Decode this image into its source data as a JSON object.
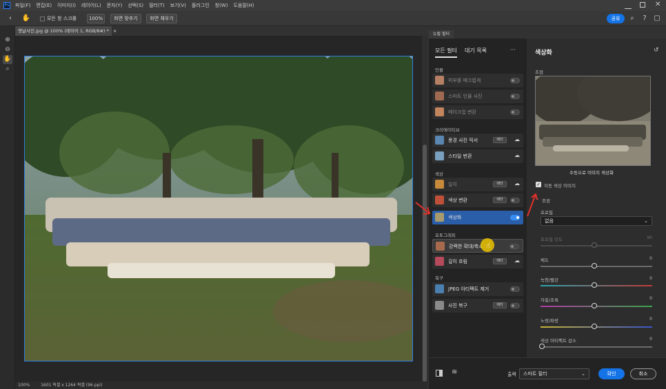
{
  "app": {
    "logo": "Ps"
  },
  "menu": [
    "파일(F)",
    "편집(E)",
    "이미지(I)",
    "레이어(L)",
    "문자(Y)",
    "선택(S)",
    "필터(T)",
    "보기(V)",
    "플러그인",
    "창(W)",
    "도움말(H)"
  ],
  "options": {
    "scroll_all": "모든 창 스크롤",
    "zoom": "100%",
    "fit_screen": "화면 맞추기",
    "fill_screen": "화면 채우기",
    "share": "공유"
  },
  "document": {
    "tab_title": "옛날사진.jpg @ 100% (레이어 1, RGB/8#) *",
    "status_zoom": "100%",
    "status_info": "1601 픽셀 x 1264 픽셀 (96 ppi)"
  },
  "panel": {
    "tab": "뉴럴 필터",
    "tabs": {
      "all": "모든 필터",
      "waitlist": "대기 목록"
    },
    "more": "···",
    "sections": [
      {
        "title": "인물",
        "items": [
          {
            "name": "피부를 매끄럽게",
            "dim": true,
            "toggle": "off"
          },
          {
            "name": "스마트 인물 사진",
            "dim": true,
            "toggle": "off"
          },
          {
            "name": "메이크업 변환",
            "dim": true,
            "toggle": "off"
          }
        ]
      },
      {
        "title": "크리에이티브",
        "items": [
          {
            "name": "풍경 사진 믹서",
            "badge": "베타",
            "cloud": true
          },
          {
            "name": "스타일 변환",
            "cloud": true
          }
        ]
      },
      {
        "title": "색상",
        "items": [
          {
            "name": "일치",
            "dim": true,
            "badge": "베타",
            "cloud": true
          },
          {
            "name": "색상 변환",
            "badge": "베타",
            "toggle": "off"
          },
          {
            "name": "색상화",
            "toggle": "on",
            "selected": true
          }
        ]
      },
      {
        "title": "포토그래피",
        "items": [
          {
            "name": "강력한 확대/축소",
            "toggle": "off",
            "hover": true
          },
          {
            "name": "깊이 흐림",
            "badge": "베타",
            "cloud": true
          }
        ]
      },
      {
        "title": "복구",
        "items": [
          {
            "name": "JPEG 아티팩트 제거",
            "toggle": "off"
          },
          {
            "name": "사진 복구",
            "badge": "베타",
            "toggle": "off"
          }
        ]
      }
    ]
  },
  "detail": {
    "title": "색상화",
    "focus_label": "초점",
    "preview_caption": "수동으로 이미지 색상화",
    "auto_color_label": "자동 색상 이미지",
    "auto_color_checked": true,
    "adjust_label": "조정",
    "profile_label": "프로필",
    "profile_value": "없음",
    "profile_strength_label": "프로필 강도",
    "profile_strength_value": "90",
    "sliders": [
      {
        "label": "채도",
        "value": "0",
        "level": 0.5
      },
      {
        "label": "녹청/빨강",
        "value": "0",
        "level": 0.5
      },
      {
        "label": "자홍/초록",
        "value": "0",
        "level": 0.5
      },
      {
        "label": "노랑/파랑",
        "value": "0",
        "level": 0.5
      },
      {
        "label": "색상 아티팩트 감소",
        "value": "0",
        "level": 0.0
      }
    ]
  },
  "footer": {
    "output_label": "출력",
    "output_value": "스마트 필터",
    "ok": "확인",
    "cancel": "취소"
  }
}
